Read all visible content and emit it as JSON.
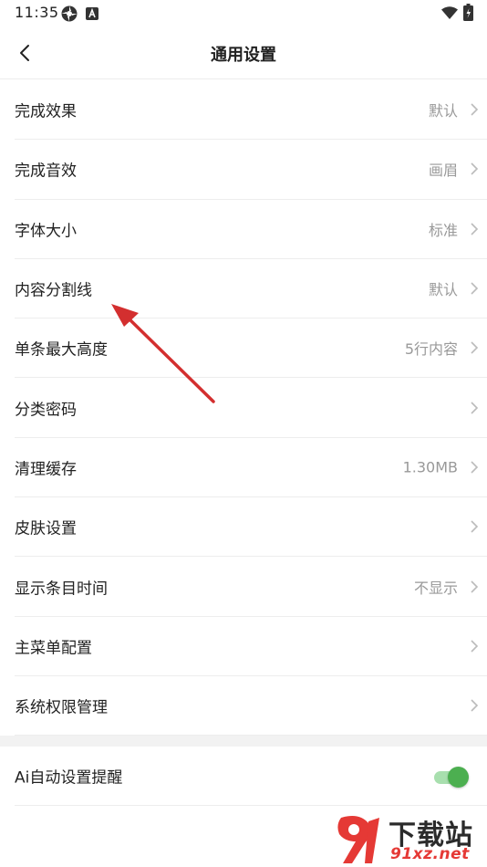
{
  "status_bar": {
    "time": "11:35",
    "icons": [
      "settings-status-icon",
      "a-notification-icon",
      "wifi-icon",
      "battery-icon"
    ]
  },
  "header": {
    "title": "通用设置",
    "back_icon": "chevron-left-icon"
  },
  "settings": {
    "items": [
      {
        "label": "完成效果",
        "value": "默认"
      },
      {
        "label": "完成音效",
        "value": "画眉"
      },
      {
        "label": "字体大小",
        "value": "标准"
      },
      {
        "label": "内容分割线",
        "value": "默认"
      },
      {
        "label": "单条最大高度",
        "value": "5行内容"
      },
      {
        "label": "分类密码",
        "value": ""
      },
      {
        "label": "清理缓存",
        "value": "1.30MB"
      },
      {
        "label": "皮肤设置",
        "value": ""
      },
      {
        "label": "显示条目时间",
        "value": "不显示"
      },
      {
        "label": "主菜单配置",
        "value": ""
      },
      {
        "label": "系统权限管理",
        "value": ""
      }
    ]
  },
  "ai_reminder": {
    "label": "Ai自动设置提醒",
    "enabled": true
  },
  "annotation": {
    "type": "red-arrow",
    "color": "#d32f2f"
  },
  "watermark": {
    "title": "下载站",
    "url": "91xz.net"
  },
  "colors": {
    "accent_green": "#4caf50",
    "value_gray": "#999999",
    "divider": "#ededed"
  }
}
